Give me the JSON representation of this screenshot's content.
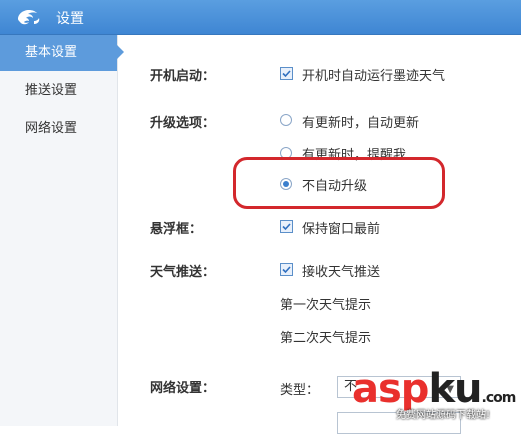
{
  "window": {
    "title": "设置",
    "icon": "cloud-logo-icon"
  },
  "sidebar": {
    "items": [
      {
        "label": "基本设置",
        "active": true
      },
      {
        "label": "推送设置",
        "active": false
      },
      {
        "label": "网络设置",
        "active": false
      }
    ]
  },
  "settings": {
    "startup": {
      "label": "开机启动：",
      "option": "开机时自动运行墨迹天气",
      "checked": true
    },
    "upgrade": {
      "label": "升级选项：",
      "options": [
        {
          "text": "有更新时，自动更新",
          "selected": false
        },
        {
          "text": "有更新时，提醒我",
          "selected": false
        },
        {
          "text": "不自动升级",
          "selected": true
        }
      ]
    },
    "floating": {
      "label": "悬浮框：",
      "option": "保持窗口最前",
      "checked": true
    },
    "push": {
      "label": "天气推送：",
      "option": "接收天气推送",
      "checked": true,
      "first": "第一次天气提示",
      "second": "第二次天气提示"
    },
    "network": {
      "label": "网络设置：",
      "type_label": "类型：",
      "type_value": "不"
    }
  },
  "watermark": {
    "brand": "aspku",
    "brand_main": "asp",
    "brand_suffix": "ku",
    "brand_tld": ".com",
    "subtitle": "免费网站源码下载站!"
  },
  "colors": {
    "titlebar": "#4a90dc",
    "active": "#5d9bdc",
    "highlight": "#d3272c",
    "watermark": "#e9302d"
  }
}
